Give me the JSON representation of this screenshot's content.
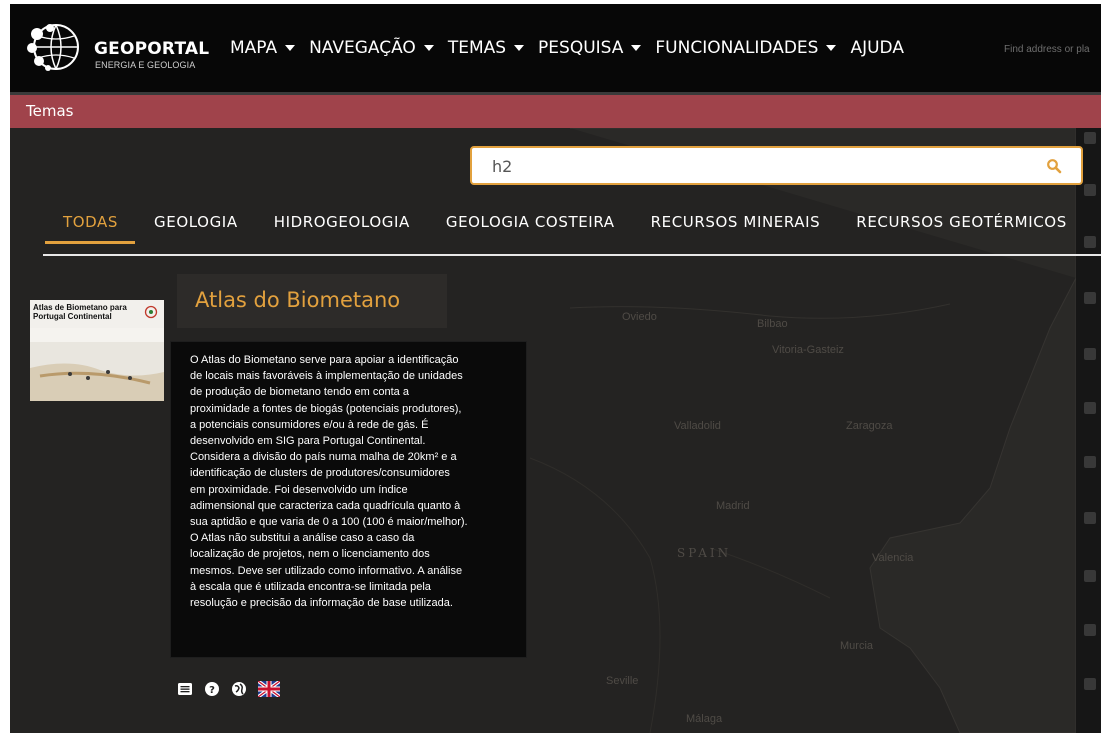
{
  "navbar": {
    "brand_title": "GEOPORTAL",
    "brand_subtitle": "ENERGIA E GEOLOGIA",
    "menu": [
      {
        "label": "MAPA",
        "dropdown": true
      },
      {
        "label": "NAVEGAÇÃO",
        "dropdown": true
      },
      {
        "label": "TEMAS",
        "dropdown": true
      },
      {
        "label": "PESQUISA",
        "dropdown": true
      },
      {
        "label": "FUNCIONALIDADES",
        "dropdown": true
      },
      {
        "label": "AJUDA",
        "dropdown": false
      }
    ],
    "find_address_placeholder": "Find address or pla"
  },
  "panel": {
    "title": "Temas",
    "header_color": "#a0434b"
  },
  "search": {
    "value": "h2",
    "accent_color": "#e2a13e"
  },
  "tabs": [
    {
      "label": "TODAS",
      "active": true
    },
    {
      "label": "GEOLOGIA",
      "active": false
    },
    {
      "label": "HIDROGEOLOGIA",
      "active": false
    },
    {
      "label": "GEOLOGIA COSTEIRA",
      "active": false
    },
    {
      "label": "RECURSOS MINERAIS",
      "active": false
    },
    {
      "label": "RECURSOS GEOTÉRMICOS",
      "active": false
    }
  ],
  "map_labels": {
    "oviedo": "Oviedo",
    "bilbao": "Bilbao",
    "vitoria": "Vitoria-Gasteiz",
    "valladolid": "Valladolid",
    "zaragoza": "Zaragoza",
    "madrid": "Madrid",
    "spain": "SPAIN",
    "valencia": "Valencia",
    "murcia": "Murcia",
    "sevilla": "Seville",
    "malaga": "Málaga"
  },
  "result": {
    "thumbnail_title": "Atlas de Biometano para Portugal Continental",
    "title": "Atlas do Biometano",
    "tooltip_lines": [
      "O Atlas do Biometano serve para apoiar a identificação",
      "de locais mais favoráveis à implementação de unidades",
      "de produção de biometano tendo em conta a",
      "proximidade a fontes de biogás (potenciais produtores),",
      "a potenciais consumidores e/ou à rede de gás. É",
      "desenvolvido em SIG para Portugal Continental.",
      "Considera a divisão do país numa malha de 20km² e a",
      "identificação de clusters de produtores/consumidores",
      "em proximidade. Foi desenvolvido um índice",
      "adimensional que caracteriza cada quadrícula quanto à",
      "sua aptidão e que varia de 0 a 100 (100 é maior/melhor).",
      "O Atlas não substitui a análise caso a caso da",
      "localização de projetos, nem o licenciamento dos",
      "mesmos. Deve ser utilizado como informativo. A análise",
      "à escala que é utilizada encontra-se limitada pela",
      "resolução e precisão da informação de base utilizada."
    ],
    "actions": [
      "metadata-icon",
      "help-icon",
      "globe-icon",
      "uk-flag-icon"
    ]
  }
}
